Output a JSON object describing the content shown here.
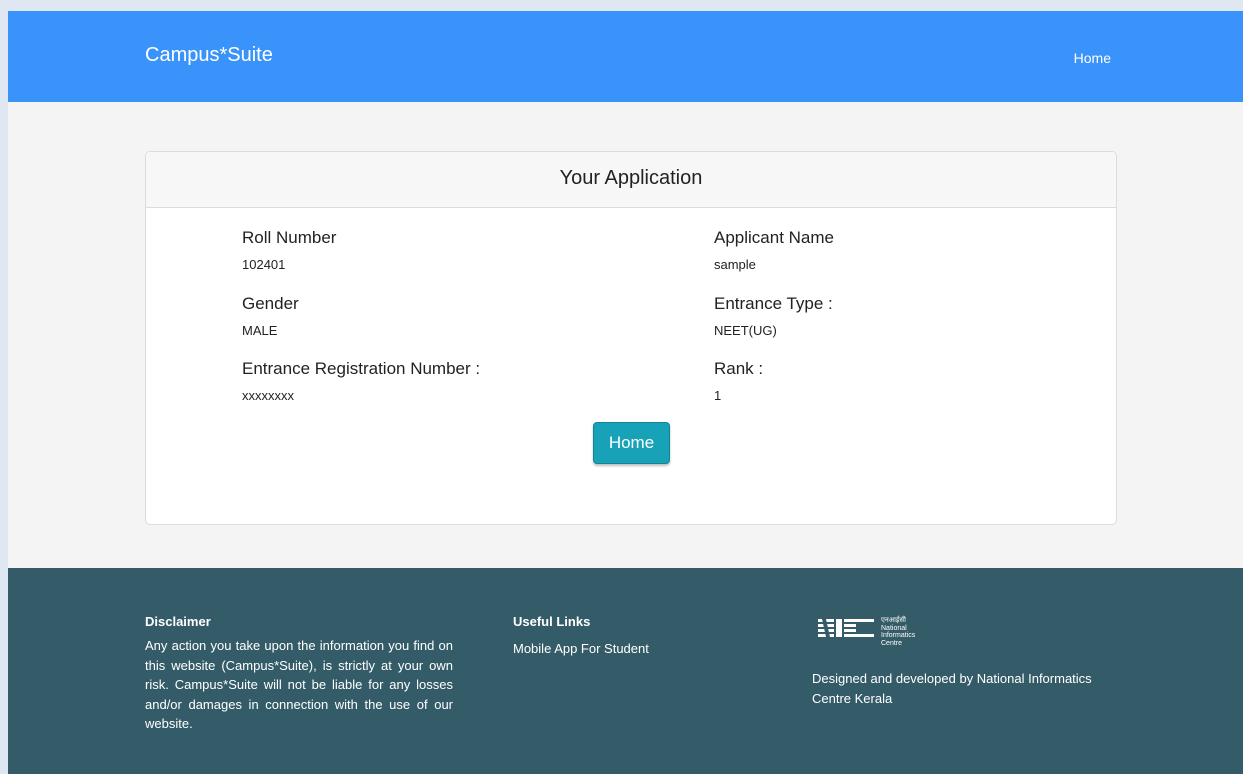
{
  "navbar": {
    "brand": "Campus*Suite",
    "home_link": "Home"
  },
  "card": {
    "title": "Your Application",
    "fields": [
      {
        "label": "Roll Number",
        "value": "102401"
      },
      {
        "label": "Applicant Name",
        "value": "sample"
      },
      {
        "label": "Gender",
        "value": "MALE"
      },
      {
        "label": "Entrance Type :",
        "value": "NEET(UG)"
      },
      {
        "label": "Entrance Registration Number :",
        "value": "xxxxxxxx"
      },
      {
        "label": "Rank :",
        "value": "1"
      }
    ],
    "home_button": "Home"
  },
  "footer": {
    "disclaimer_title": "Disclaimer",
    "disclaimer_text": "Any action you take upon the information you find on this website (Campus*Suite), is strictly at your own risk. Campus*Suite will not be liable for any losses and/or damages in connection with the use of our website.",
    "links_title": "Useful Links",
    "links": [
      "Mobile App For Student"
    ],
    "logo": {
      "hindi": "एनआईसी",
      "line1": "National",
      "line2": "Informatics",
      "line3": "Centre",
      "mark": "NIC"
    },
    "credit": "Designed and developed by National Informatics Centre Kerala"
  },
  "colors": {
    "navbar": "#3a93fb",
    "footer": "#345c68",
    "button": "#17a2b8"
  }
}
